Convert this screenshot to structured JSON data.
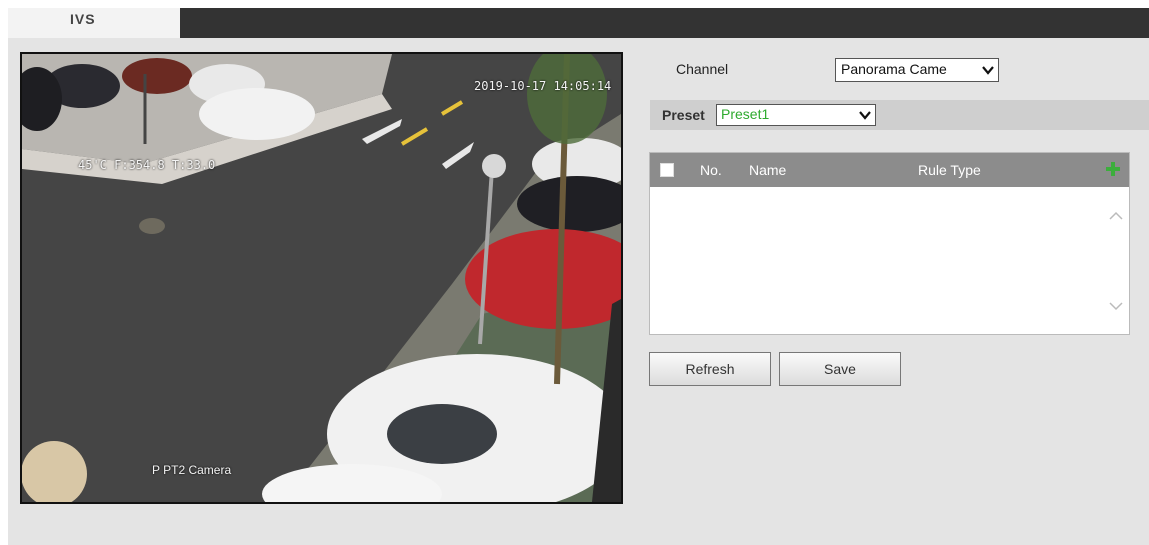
{
  "tab": {
    "label": "IVS"
  },
  "video": {
    "timestamp": "2019-10-17 14:05:14",
    "ptz_readout": "45'C F:354.8 T:33.0",
    "camera_name": "P PT2 Camera"
  },
  "channel": {
    "label": "Channel",
    "value": "Panorama Came"
  },
  "preset": {
    "label": "Preset",
    "value": "Preset1"
  },
  "rules": {
    "columns": [
      "No.",
      "Name",
      "Rule Type"
    ],
    "rows": []
  },
  "buttons": {
    "refresh": "Refresh",
    "save": "Save"
  },
  "colors": {
    "preset_value": "#2eaa2e",
    "add_icon": "#3cae3c",
    "header": "#8c8c8c"
  }
}
